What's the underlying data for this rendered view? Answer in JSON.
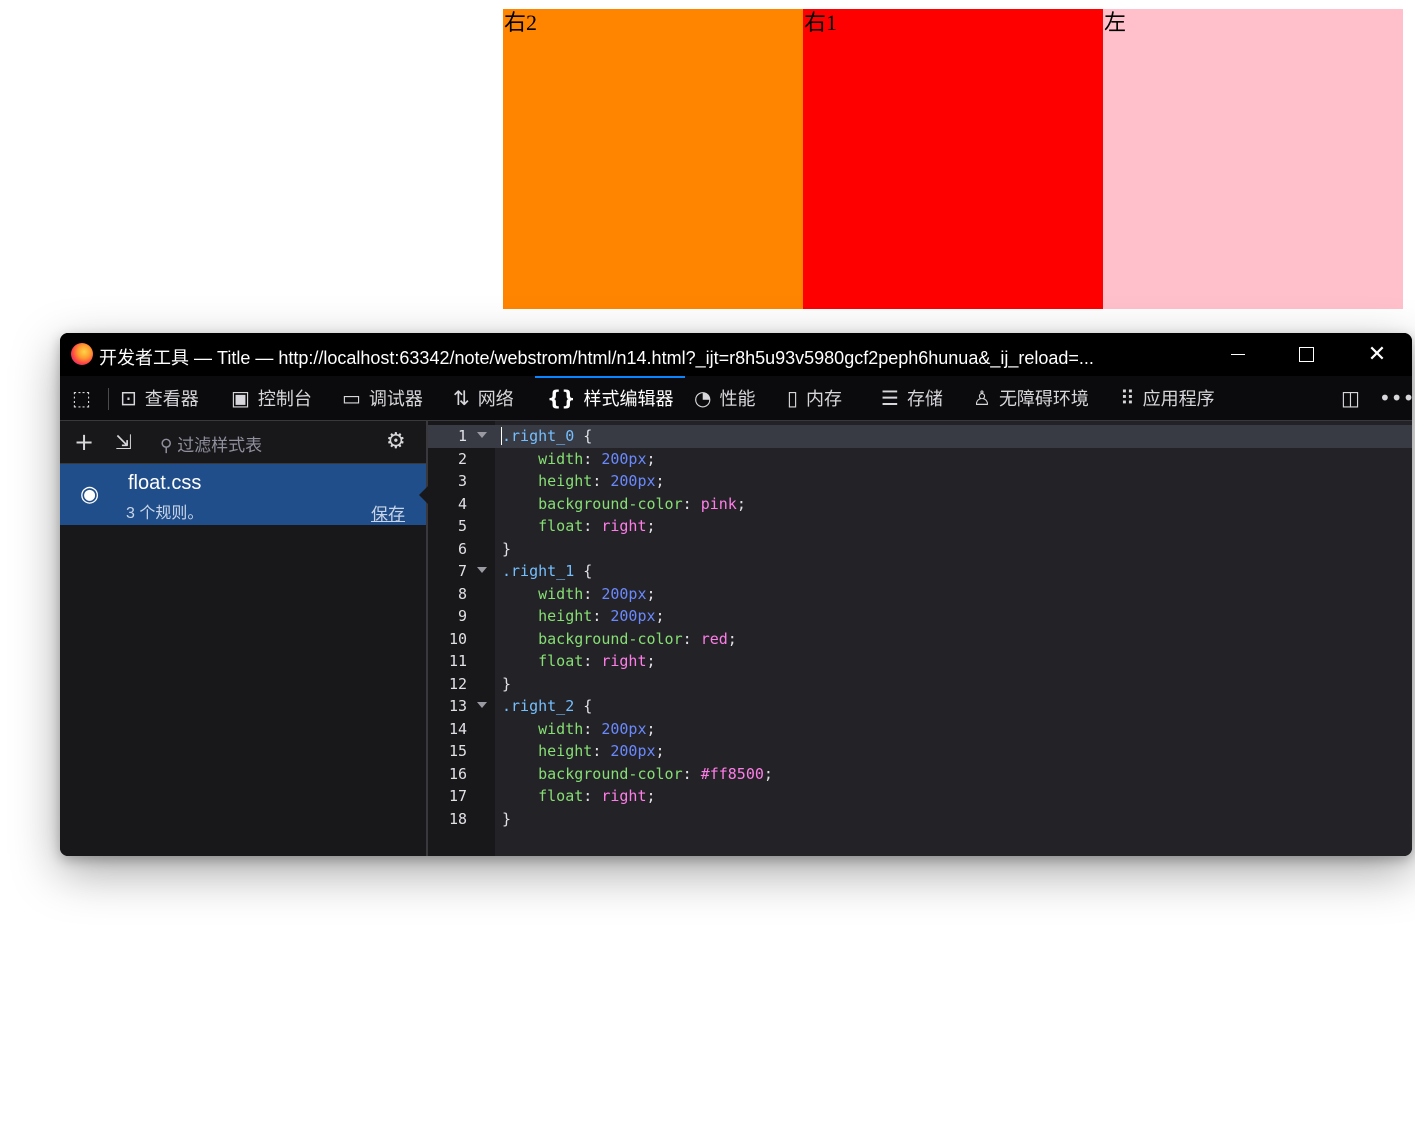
{
  "page": {
    "boxes": [
      {
        "id": "right_2",
        "label": "右2",
        "color": "#ff8500"
      },
      {
        "id": "right_1",
        "label": "右1",
        "color": "#ff0000"
      },
      {
        "id": "right_0",
        "label": "左",
        "color": "#ffc0cb"
      }
    ]
  },
  "window": {
    "title": "开发者工具 — Title — http://localhost:63342/note/webstrom/html/n14.html?_ijt=r8h5u93v5980gcf2peph6hunua&_ij_reload=..."
  },
  "toolbar": {
    "picker_icon": "element-picker-icon",
    "tabs": [
      {
        "label": "查看器",
        "icon": "inspector-icon"
      },
      {
        "label": "控制台",
        "icon": "console-icon"
      },
      {
        "label": "调试器",
        "icon": "debugger-icon"
      },
      {
        "label": "网络",
        "icon": "network-icon"
      },
      {
        "label": "样式编辑器",
        "icon": "style-editor-icon",
        "active": true
      },
      {
        "label": "性能",
        "icon": "performance-icon"
      },
      {
        "label": "内存",
        "icon": "memory-icon"
      },
      {
        "label": "存储",
        "icon": "storage-icon"
      },
      {
        "label": "无障碍环境",
        "icon": "accessibility-icon"
      },
      {
        "label": "应用程序",
        "icon": "application-icon"
      }
    ]
  },
  "sidebar": {
    "filter_placeholder": "过滤样式表",
    "sheet": {
      "name": "float.css",
      "rules": "3 个规则。",
      "save": "保存"
    }
  },
  "editor": {
    "lines": [
      ".right_0 {",
      "    width: 200px;",
      "    height: 200px;",
      "    background-color: pink;",
      "    float: right;",
      "}",
      ".right_1 {",
      "    width: 200px;",
      "    height: 200px;",
      "    background-color: red;",
      "    float: right;",
      "}",
      ".right_2 {",
      "    width: 200px;",
      "    height: 200px;",
      "    background-color: #ff8500;",
      "    float: right;",
      "}"
    ],
    "current_line": 1,
    "fold_lines": [
      1,
      7,
      13
    ]
  }
}
